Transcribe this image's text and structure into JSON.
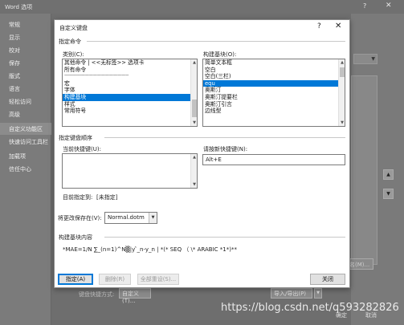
{
  "background": {
    "title": "Word 选项",
    "help_glyph": "?",
    "close_glyph": "✕",
    "nav": [
      "常规",
      "显示",
      "校对",
      "保存",
      "版式",
      "语言",
      "轻松访问",
      "高级",
      "自定义功能区",
      "快速访问工具栏",
      "加载项",
      "信任中心"
    ],
    "nav_active_index": 8,
    "rename_button": "名(M)...",
    "keyboard_label": "键盘快捷方式:",
    "keyboard_button": "自定义(T)...",
    "import_export_button": "导入/导出(P)",
    "ok_button": "确定",
    "cancel_button": "取消",
    "watermark": "https://blog.csdn.net/q593282826"
  },
  "dialog": {
    "title": "自定义键盘",
    "help_glyph": "?",
    "close_glyph": "✕",
    "specify_command_group": "指定命令",
    "categories_label": "类别(C):",
    "categories": [
      "其他命令 | <<无标签>> 选项卡",
      "所有命令",
      "------------------------------------------------",
      "宏",
      "字体",
      "构建基块",
      "样式",
      "常用符号"
    ],
    "categories_selected_index": 5,
    "building_blocks_label": "构建基块(O):",
    "building_blocks": [
      "简单文本框",
      "空白",
      "空白(三栏)",
      "equ",
      "奥斯汀",
      "奥斯汀提要栏",
      "奥斯汀引言",
      "边线型"
    ],
    "building_blocks_selected_index": 3,
    "key_sequence_group": "指定键盘顺序",
    "current_keys_label": "当前快捷键(U):",
    "new_key_label": "请按新快捷键(N):",
    "new_key_value": "Alt+E",
    "currently_assigned_label": "目前指定到:",
    "currently_assigned_value": "[未指定]",
    "save_changes_label": "将更改保存在(V):",
    "save_changes_value": "Normal.dotm",
    "description_group": "构建基块内容",
    "description_text": "*MAE=1/N ∑_(n=1)^N▒|y ̂_n-y_n | *(* SEQ （ \\* ARABIC *1*)**",
    "assign_button": "指定(A)",
    "remove_button": "删除(R)",
    "reset_all_button": "全部重设(S)...",
    "close_button": "关闭"
  }
}
